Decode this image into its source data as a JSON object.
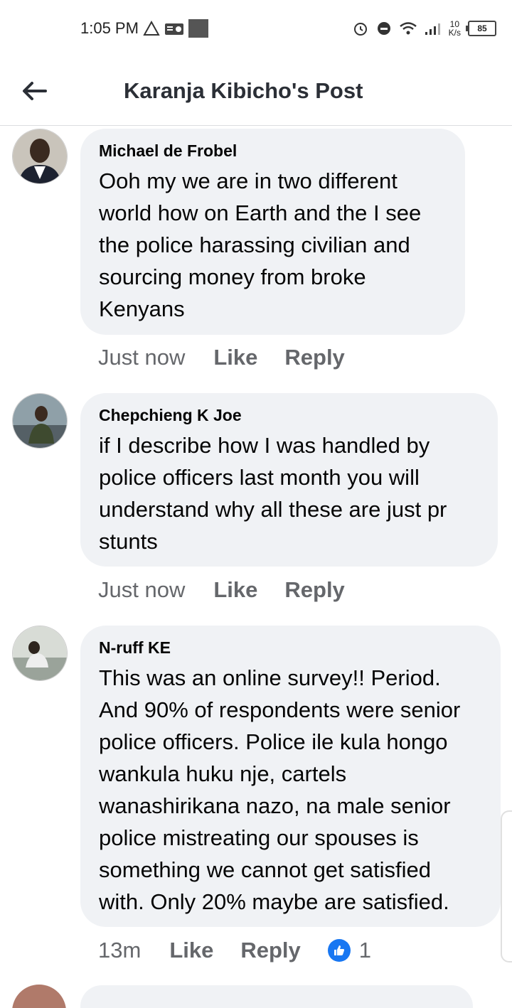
{
  "status_bar": {
    "time": "1:05 PM",
    "net_speed_value": "10",
    "net_speed_unit": "K/s",
    "battery": "85"
  },
  "header": {
    "title": "Karanja Kibicho's Post"
  },
  "comments": [
    {
      "author": "Michael de Frobel",
      "text": "Ooh my we are in two different world how on Earth and the I see the police harassing civilian and sourcing money from broke Kenyans",
      "time": "Just now",
      "like_label": "Like",
      "reply_label": "Reply"
    },
    {
      "author": "Chepchieng K Joe",
      "text": "if I describe how I was handled by police officers last month you will understand why all these are just pr stunts",
      "time": "Just now",
      "like_label": "Like",
      "reply_label": "Reply"
    },
    {
      "author": "N-ruff KE",
      "text": "This was an online survey!! Period. And 90% of respondents were senior police officers. Police ile kula hongo wankula huku nje, cartels wanashirikana nazo, na male senior police mistreating our spouses is something we cannot get satisfied with. Only 20% maybe are satisfied.",
      "time": "13m",
      "like_label": "Like",
      "reply_label": "Reply",
      "reaction_count": "1"
    }
  ],
  "colors": {
    "bubble": "#f0f2f5",
    "secondary_text": "#65676b",
    "like_blue": "#1877f2"
  }
}
